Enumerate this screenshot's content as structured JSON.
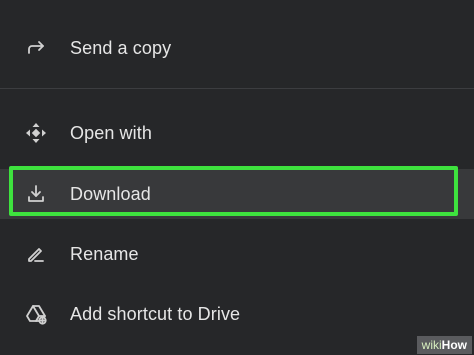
{
  "menu": {
    "items": [
      {
        "label": "Send a copy",
        "icon": "send-arrow-icon"
      },
      {
        "label": "Open with",
        "icon": "move-arrows-icon"
      },
      {
        "label": "Download",
        "icon": "download-icon"
      },
      {
        "label": "Rename",
        "icon": "pencil-icon"
      },
      {
        "label": "Add shortcut to Drive",
        "icon": "add-to-drive-icon"
      }
    ]
  },
  "watermark": {
    "part_a": "wiki",
    "part_b": "How"
  },
  "colors": {
    "background": "#262729",
    "highlight": "#3ee23e",
    "text": "#e6e6e6",
    "selected_row": "#38393b"
  }
}
